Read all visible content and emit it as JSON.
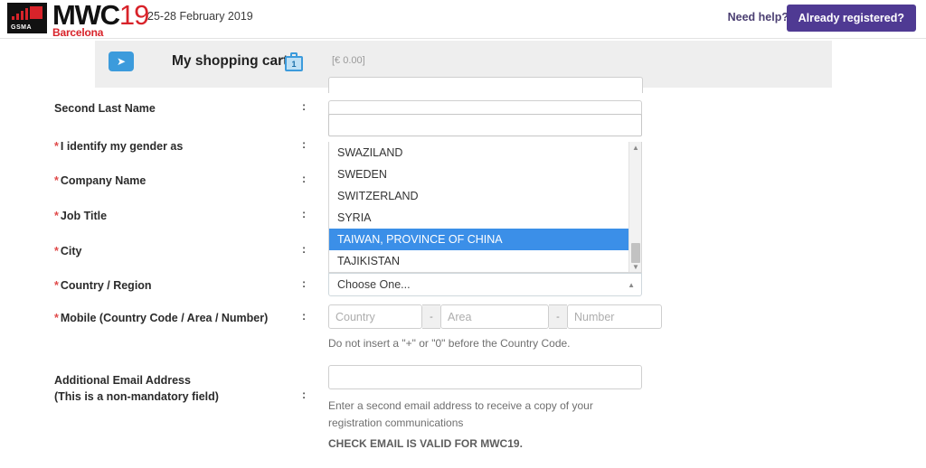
{
  "header": {
    "logo_mwc": "MWC",
    "logo_year": "19",
    "logo_city": "Barcelona",
    "logo_gsma": "GSMA",
    "date": "25-28 February 2019",
    "need_help": "Need help?",
    "already_registered": "Already registered?",
    "accent_purple": "#4f3a93",
    "accent_red": "#d8232a"
  },
  "cart": {
    "title": "My shopping cart",
    "count": "1",
    "price": "[€ 0.00]",
    "arrow_icon": "chevron-right-icon",
    "case_icon": "briefcase-icon",
    "accent_blue": "#3c9bdc"
  },
  "form": {
    "colon": ":",
    "required_mark": "*",
    "fields": [
      {
        "label": "Second Last Name",
        "required": false
      },
      {
        "label": "I identify my gender as",
        "required": true
      },
      {
        "label": "Company Name",
        "required": true
      },
      {
        "label": "Job Title",
        "required": true
      },
      {
        "label": "City",
        "required": true
      },
      {
        "label": "Country / Region",
        "required": true
      },
      {
        "label": "Mobile (Country Code / Area / Number)",
        "required": true
      },
      {
        "label_line1": "Additional Email Address",
        "label_line2": "(This is a non-mandatory field)",
        "required": false
      }
    ],
    "dropdown": {
      "search_value": "",
      "selected_display": "Choose One...",
      "chevron_icon": "chevron-up-icon",
      "scroll_up_icon": "triangle-up-icon",
      "scroll_down_icon": "triangle-down-icon",
      "highlight_color": "#3b8fe8",
      "options": [
        "SWAZILAND",
        "SWEDEN",
        "SWITZERLAND",
        "SYRIA",
        "TAIWAN, PROVINCE OF CHINA",
        "TAJIKISTAN"
      ],
      "selected_index": 4
    },
    "mobile": {
      "country_placeholder": "Country",
      "area_placeholder": "Area",
      "number_placeholder": "Number",
      "separator": "-",
      "hint": "Do not insert a \"+\" or \"0\" before the Country Code."
    },
    "email": {
      "value": "",
      "hint": "Enter a second email address to receive a copy of your registration communications",
      "notice": "CHECK EMAIL IS VALID FOR MWC19."
    }
  }
}
